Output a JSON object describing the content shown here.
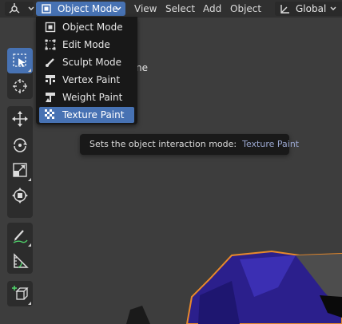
{
  "header": {
    "editor_type_icon": "3d-viewport-icon",
    "mode_label": "Object Mode",
    "menus": [
      "View",
      "Select",
      "Add",
      "Object"
    ],
    "orientation_label": "Global"
  },
  "viewport": {
    "partial_text": "ne"
  },
  "mode_menu": {
    "items": [
      {
        "label": "Object Mode",
        "icon": "object-mode-icon"
      },
      {
        "label": "Edit Mode",
        "icon": "edit-mode-icon"
      },
      {
        "label": "Sculpt Mode",
        "icon": "sculpt-mode-icon"
      },
      {
        "label": "Vertex Paint",
        "icon": "vertex-paint-icon"
      },
      {
        "label": "Weight Paint",
        "icon": "weight-paint-icon"
      },
      {
        "label": "Texture Paint",
        "icon": "texture-paint-icon"
      }
    ],
    "selected": "Texture Paint"
  },
  "tooltip": {
    "text": "Sets the object interaction mode:",
    "value": "Texture Paint"
  },
  "toolbar": {
    "tools": [
      "select-box-icon",
      "cursor-icon",
      "move-icon",
      "rotate-icon",
      "scale-icon",
      "transform-icon",
      "annotate-icon",
      "measure-icon",
      "add-cube-icon"
    ]
  },
  "colors": {
    "accent": "#4772b3",
    "header_bg": "#303030",
    "viewport_bg": "#3d3d3d",
    "menu_bg": "#181818",
    "selection_outline": "#e8892a",
    "mesh_color": "#2a1f8a"
  }
}
